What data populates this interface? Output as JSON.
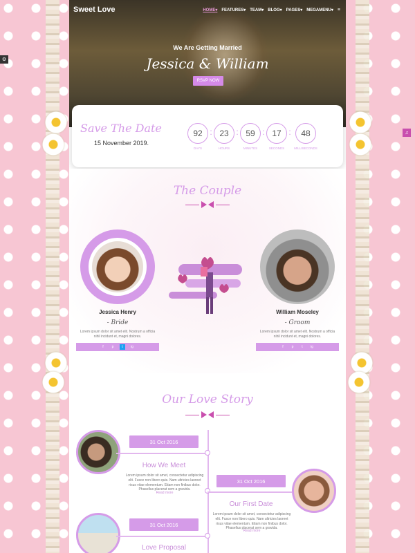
{
  "brand": "Sweet Love",
  "nav": [
    {
      "label": "HOME",
      "arrow": "▾"
    },
    {
      "label": "FEATURES",
      "arrow": "▾"
    },
    {
      "label": "TEAM",
      "arrow": "▾"
    },
    {
      "label": "BLOG",
      "arrow": "▾"
    },
    {
      "label": "PAGES",
      "arrow": "▾"
    },
    {
      "label": "MEGAMENU",
      "arrow": "▾"
    }
  ],
  "hero": {
    "subtitle": "We Are Getting Married",
    "title": "Jessica & William",
    "rsvp": "RSVP NOW"
  },
  "save_the_date": {
    "title": "Save The Date",
    "date": "15 November 2019.",
    "counters": [
      {
        "value": "92",
        "label": "DAYS"
      },
      {
        "value": "23",
        "label": "HOURS"
      },
      {
        "value": "59",
        "label": "MINUTES"
      },
      {
        "value": "17",
        "label": "SECONDS"
      },
      {
        "value": "48",
        "label": "MILLISECONDS"
      }
    ],
    "separator": ":"
  },
  "couple": {
    "title": "The Couple",
    "bride": {
      "name": "Jessica Henry",
      "role": "- Bride",
      "bio": "Lorem ipsum dolor sit amet elit. Nostrum a officia nihil incidunt et, magni dolores."
    },
    "groom": {
      "name": "William Moseley",
      "role": "- Groom",
      "bio": "Lorem ipsum dolor sit amet elit. Nostrum a officia nihil incidunt et, magni dolores."
    },
    "social_icons": [
      "f",
      "p",
      "t",
      "ig"
    ]
  },
  "story": {
    "title": "Our Love Story",
    "items": [
      {
        "date": "31 Oct 2016",
        "heading": "How We Meet",
        "text": "Lorem ipsum dolor sit amet, consectetur adipiscing elit. Fusce non libero quis. Nam ultricies laoreet risus vitae elementum. Etiam non finibus dolor. Phasellus placerat sem a gravida.",
        "link": "Read more"
      },
      {
        "date": "31 Oct 2016",
        "heading": "Our First Date",
        "text": "Lorem ipsum dolor sit amet, consectetur adipiscing elit. Fusce non libero quis. Nam ultricies laoreet risus vitae elementum. Etiam non finibus dolor. Phasellus placerat sem a gravida.",
        "link": "Read more"
      },
      {
        "date": "31 Oct 2016",
        "heading": "Love Proposal",
        "text": "",
        "link": ""
      }
    ]
  },
  "side_buttons": {
    "settings": "⚙",
    "music": "♫"
  }
}
